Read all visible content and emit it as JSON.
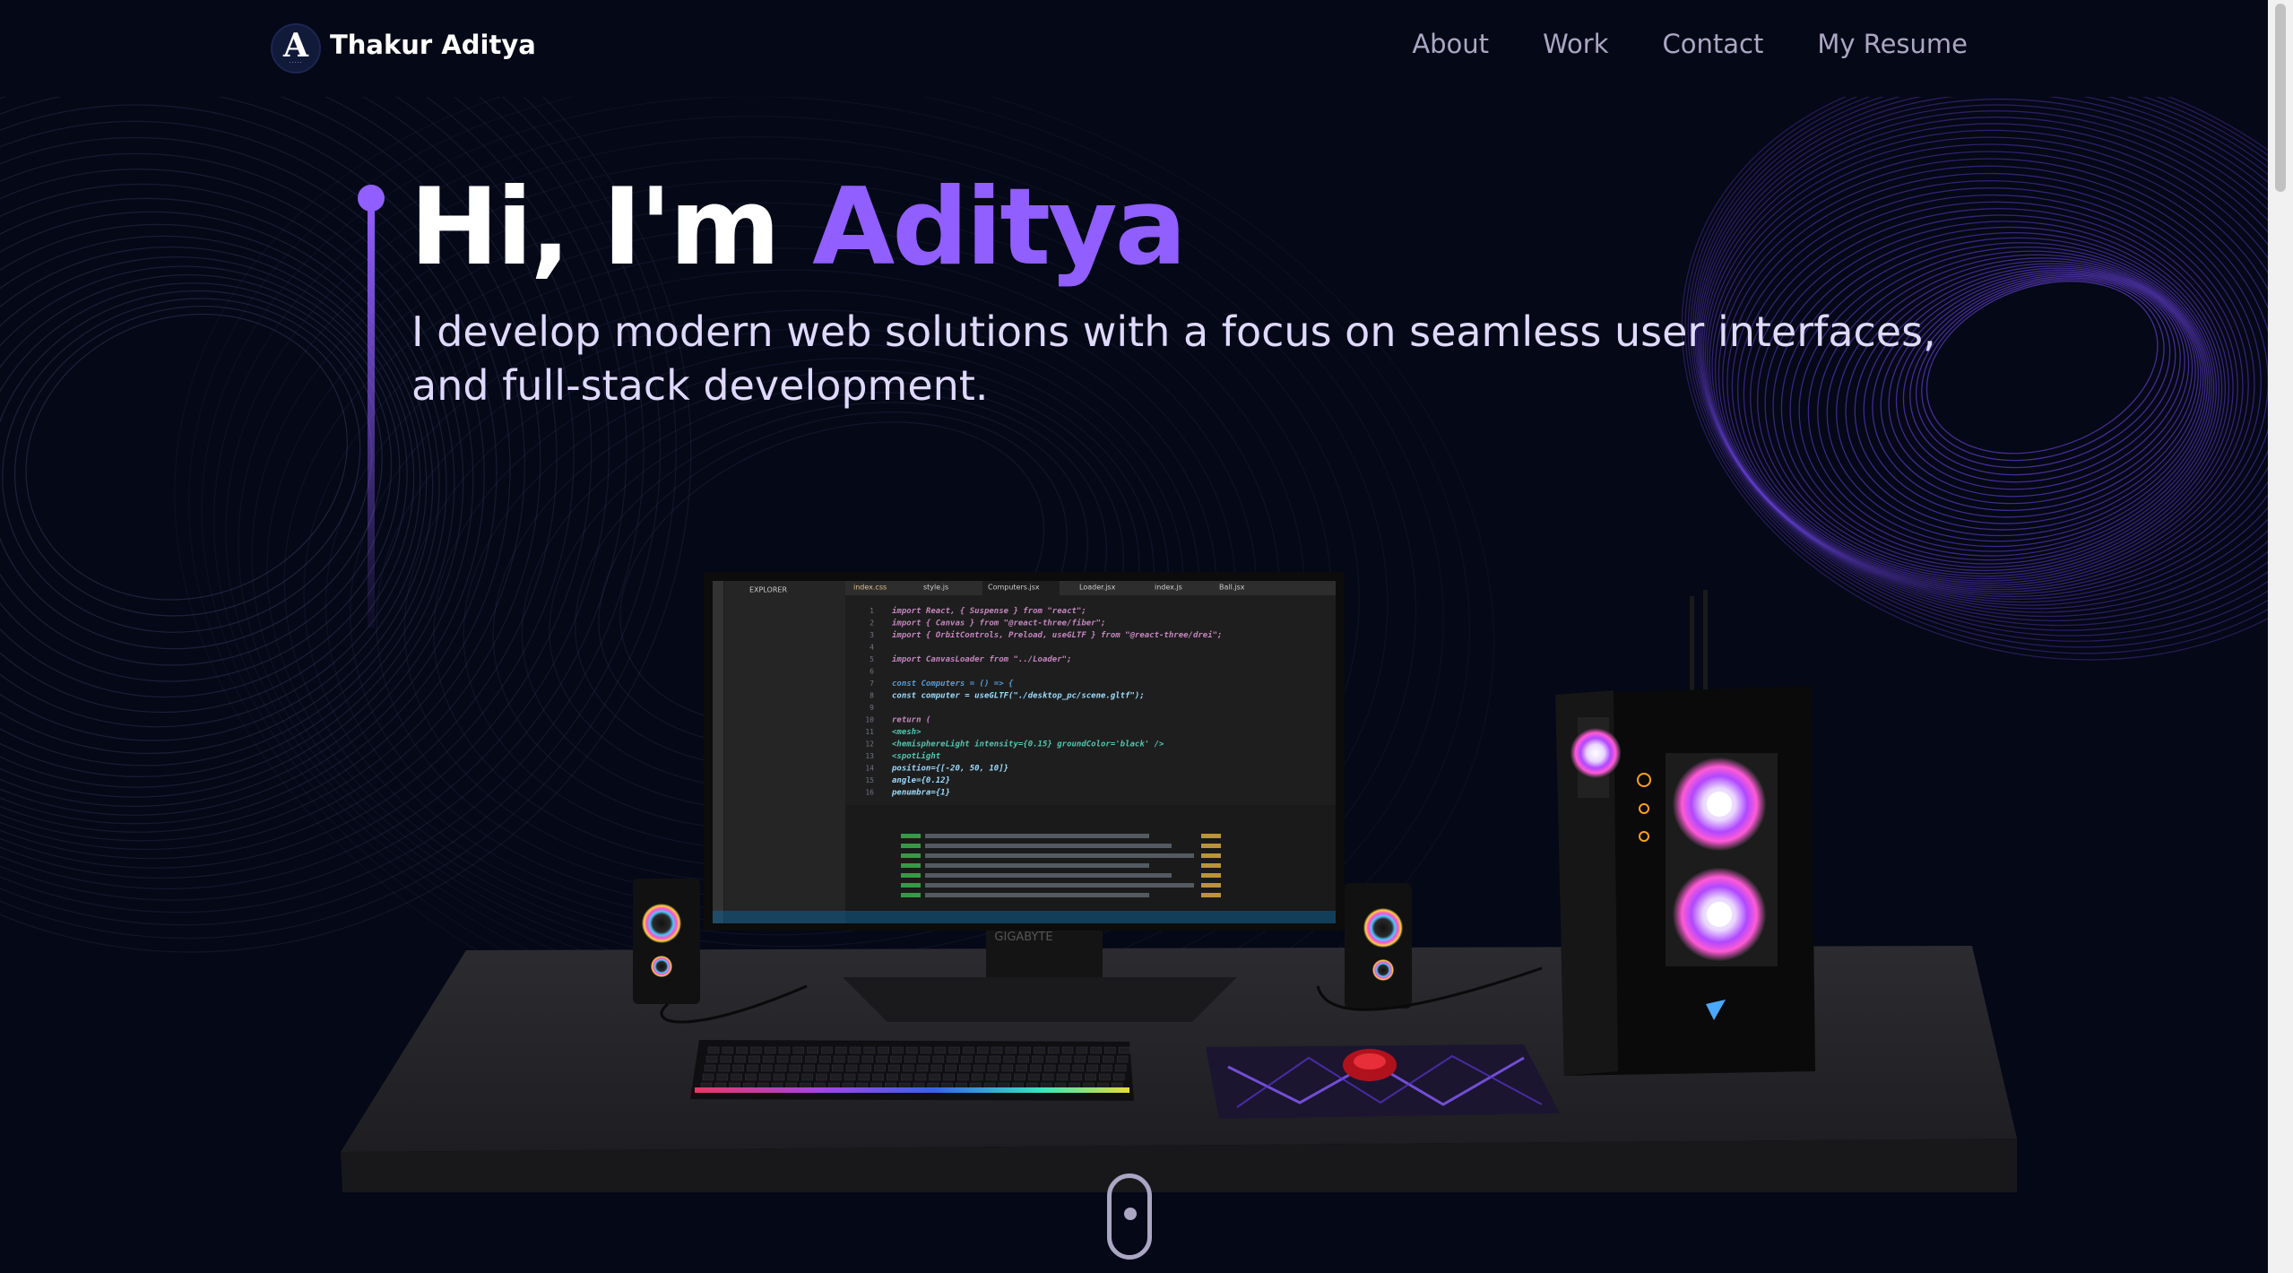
{
  "colors": {
    "background": "#050816",
    "accent": "#915eff",
    "secondary_text": "#aaa6c3",
    "hero_sub_text": "#dfd9ff"
  },
  "nav": {
    "logo_icon": "logo-a-icon",
    "brand": "Thakur Aditya",
    "links": [
      "About",
      "Work",
      "Contact",
      "My Resume"
    ]
  },
  "hero": {
    "title_prefix": "Hi, I'm ",
    "title_name": "Aditya",
    "subtitle": "I develop modern web solutions with a focus on seamless user interfaces, and full-stack development."
  },
  "monitor": {
    "brand": "GIGABYTE",
    "editor_tabs": [
      "index.css",
      "style.js",
      "Computers.jsx",
      "Loader.jsx",
      "index.js",
      "Ball.jsx"
    ],
    "explorer_title": "EXPLORER",
    "code_lines": [
      "import React, { Suspense } from \"react\";",
      "import { Canvas } from \"@react-three/fiber\";",
      "import { OrbitControls, Preload, useGLTF } from \"@react-three/drei\";",
      "",
      "import CanvasLoader from \"../Loader\";",
      "",
      "const Computers = () => {",
      "  const computer = useGLTF(\"./desktop_pc/scene.gltf\");",
      "",
      "  return (",
      "    <mesh>",
      "      <hemisphereLight intensity={0.15} groundColor='black' />",
      "      <spotLight",
      "        position={[-20, 50, 10]}",
      "        angle={0.12}",
      "        penumbra={1}"
    ]
  },
  "scroll_indicator_icon": "mouse-scroll-icon"
}
